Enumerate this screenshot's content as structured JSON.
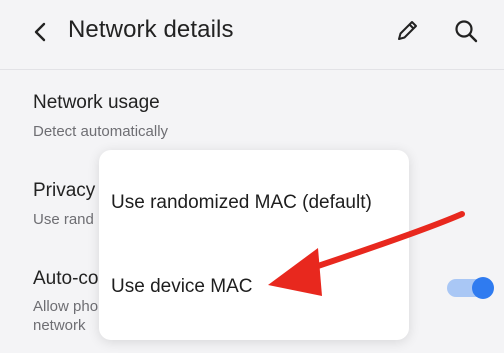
{
  "header": {
    "title": "Network details",
    "back_icon": "chevron-left-icon",
    "edit_icon": "pencil-icon",
    "search_icon": "search-icon"
  },
  "settings": {
    "network_usage": {
      "title": "Network usage",
      "subtitle": "Detect automatically"
    },
    "privacy": {
      "title": "Privacy",
      "subtitle": "Use rand"
    },
    "auto_connect": {
      "title": "Auto-co",
      "subtitle_line1": "Allow pho",
      "subtitle_line2": "network",
      "toggle_on": true
    }
  },
  "dialog": {
    "options": [
      {
        "label": "Use randomized MAC (default)"
      },
      {
        "label": "Use device MAC"
      }
    ]
  },
  "colors": {
    "background": "#f4f4f6",
    "toggle_accent": "#2f7bf0",
    "annotation_arrow": "#e8281e"
  }
}
